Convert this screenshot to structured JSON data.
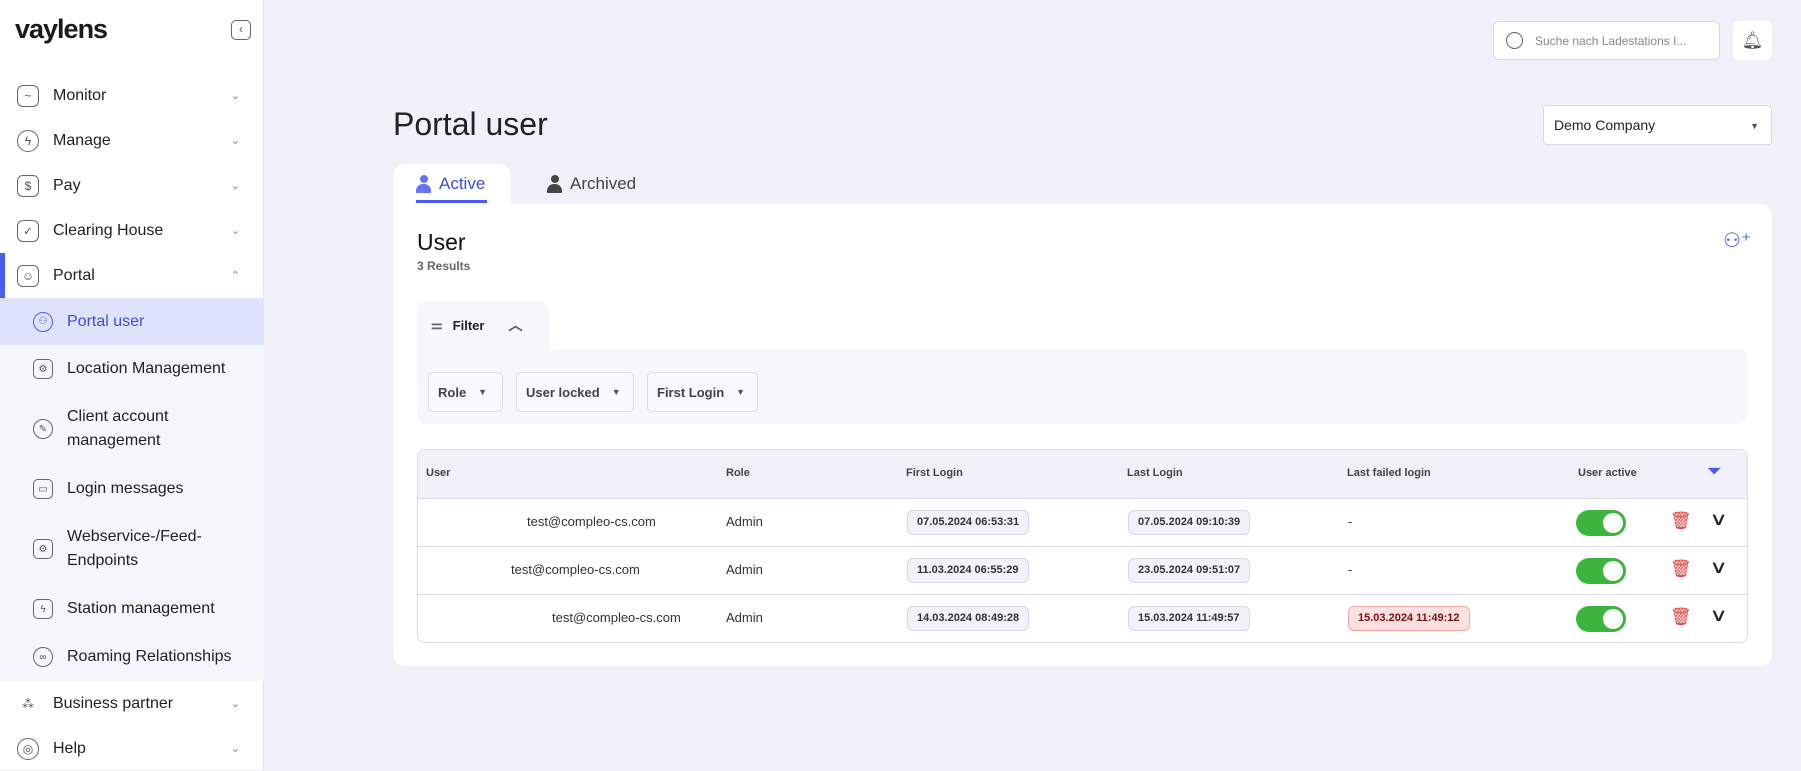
{
  "brand": "vaylens",
  "sidebar": {
    "items": [
      {
        "label": "Monitor",
        "icon": "chart-line-icon"
      },
      {
        "label": "Manage",
        "icon": "bolt-icon"
      },
      {
        "label": "Pay",
        "icon": "dollar-icon"
      },
      {
        "label": "Clearing House",
        "icon": "clipboard-check-icon"
      },
      {
        "label": "Portal",
        "icon": "user-shield-icon"
      },
      {
        "label": "Business partner",
        "icon": "network-icon"
      },
      {
        "label": "Help",
        "icon": "lifebuoy-icon"
      }
    ],
    "sub_items": [
      {
        "label": "Portal user"
      },
      {
        "label": "Location Management"
      },
      {
        "label": "Client account management"
      },
      {
        "label": "Login messages"
      },
      {
        "label": "Webservice-/Feed-Endpoints"
      },
      {
        "label": "Station management"
      },
      {
        "label": "Roaming Relationships"
      }
    ]
  },
  "search": {
    "placeholder": "Suche nach Ladestations I..."
  },
  "page": {
    "title": "Portal user",
    "company": "Demo Company"
  },
  "tabs": [
    {
      "label": "Active"
    },
    {
      "label": "Archived"
    }
  ],
  "card": {
    "title": "User",
    "count": "3 Results"
  },
  "filter": {
    "label": "Filter",
    "dropdowns": [
      "Role",
      "User locked",
      "First Login"
    ]
  },
  "table": {
    "headers": [
      "User",
      "Role",
      "First Login",
      "Last Login",
      "Last failed login",
      "User active"
    ],
    "rows": [
      {
        "user": "test@compleo-cs.com",
        "role": "Admin",
        "first": "07.05.2024 06:53:31",
        "last": "07.05.2024 09:10:39",
        "failed": "-"
      },
      {
        "user": "test@compleo-cs.com",
        "role": "Admin",
        "first": "11.03.2024 06:55:29",
        "last": "23.05.2024 09:51:07",
        "failed": "-"
      },
      {
        "user": "test@compleo-cs.com",
        "role": "Admin",
        "first": "14.03.2024 08:49:28",
        "last": "15.03.2024 11:49:57",
        "failed": "15.03.2024 11:49:12"
      }
    ]
  },
  "colors": {
    "accent": "#4a5cf5",
    "toggle_on": "#3db53d",
    "danger": "#e83c3c"
  }
}
